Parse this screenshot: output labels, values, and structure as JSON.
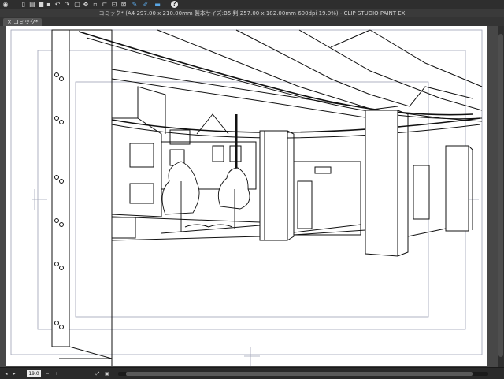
{
  "toolbar": {
    "buttons": [
      {
        "name": "display-icon",
        "glyph": "◉"
      },
      {
        "name": "new-file-icon",
        "glyph": "▯"
      },
      {
        "name": "open-file-icon",
        "glyph": "▤"
      },
      {
        "name": "save-icon",
        "glyph": "■"
      },
      {
        "name": "save-as-icon",
        "glyph": "▪"
      },
      {
        "name": "undo-icon",
        "glyph": "↶"
      },
      {
        "name": "redo-icon",
        "glyph": "↷"
      },
      {
        "name": "clear-icon",
        "glyph": "▢"
      },
      {
        "name": "move-icon",
        "glyph": "✥"
      },
      {
        "name": "select-icon",
        "glyph": "▫"
      },
      {
        "name": "crop-icon",
        "glyph": "⊏"
      },
      {
        "name": "transform-icon",
        "glyph": "⊡"
      },
      {
        "name": "ruler-icon",
        "glyph": "⊠"
      },
      {
        "name": "pen-icon",
        "glyph": "✎"
      },
      {
        "name": "brush-icon",
        "glyph": "✐"
      },
      {
        "name": "eraser-icon",
        "glyph": "▬"
      },
      {
        "name": "help-icon",
        "glyph": "?"
      }
    ]
  },
  "window": {
    "title": "コミック* (A4 297.00 x 210.00mm 製本サイズ:B5 判 257.00 x 182.00mm 600dpi 19.0%)  - CLIP STUDIO PAINT EX"
  },
  "tabs": [
    {
      "label": "コミック*",
      "close_glyph": "×"
    }
  ],
  "status": {
    "zoom": "19.0",
    "buttons": [
      "◂",
      "▸",
      "−",
      "+",
      "⤢",
      "▣"
    ]
  },
  "colors": {
    "canvas_bg": "#474747",
    "paper": "#ffffff",
    "guide": "#9ca0b4",
    "accent": "#5aa7e6"
  }
}
